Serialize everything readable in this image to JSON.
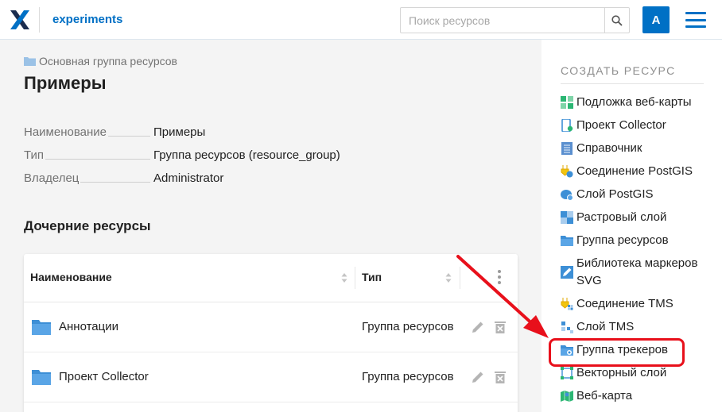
{
  "header": {
    "app_title": "experiments",
    "search_placeholder": "Поиск ресурсов",
    "avatar_letter": "A",
    "colors": {
      "brand": "#0070c5"
    }
  },
  "main": {
    "breadcrumb": "Основная группа ресурсов",
    "page_title": "Примеры",
    "properties": [
      {
        "label": "Наименование",
        "value": "Примеры"
      },
      {
        "label": "Тип",
        "value": "Группа ресурсов (resource_group)"
      },
      {
        "label": "Владелец",
        "value": "Administrator"
      }
    ],
    "children_title": "Дочерние ресурсы",
    "table": {
      "columns": {
        "name": "Наименование",
        "type": "Тип"
      },
      "rows": [
        {
          "name": "Аннотации",
          "type": "Группа ресурсов",
          "icon": "folder-icon"
        },
        {
          "name": "Проект Collector",
          "type": "Группа ресурсов",
          "icon": "folder-icon"
        }
      ]
    }
  },
  "sidebar": {
    "title": "СОЗДАТЬ РЕСУРС",
    "items": [
      {
        "label": "Подложка веб-карты",
        "icon": "basemap-icon"
      },
      {
        "label": "Проект Collector",
        "icon": "collector-icon"
      },
      {
        "label": "Справочник",
        "icon": "lookup-table-icon"
      },
      {
        "label": "Соединение PostGIS",
        "icon": "postgis-connection-icon"
      },
      {
        "label": "Слой PostGIS",
        "icon": "postgis-layer-icon"
      },
      {
        "label": "Растровый слой",
        "icon": "raster-layer-icon"
      },
      {
        "label": "Группа ресурсов",
        "icon": "resource-group-icon"
      },
      {
        "label": "Библиотека маркеров SVG",
        "icon": "svg-marker-library-icon"
      },
      {
        "label": "Соединение TMS",
        "icon": "tms-connection-icon"
      },
      {
        "label": "Слой TMS",
        "icon": "tms-layer-icon"
      },
      {
        "label": "Группа трекеров",
        "icon": "tracker-group-icon",
        "highlighted": true
      },
      {
        "label": "Векторный слой",
        "icon": "vector-layer-icon"
      },
      {
        "label": "Веб-карта",
        "icon": "webmap-icon"
      }
    ]
  },
  "annotation": {
    "highlight_color": "#e8101b"
  }
}
